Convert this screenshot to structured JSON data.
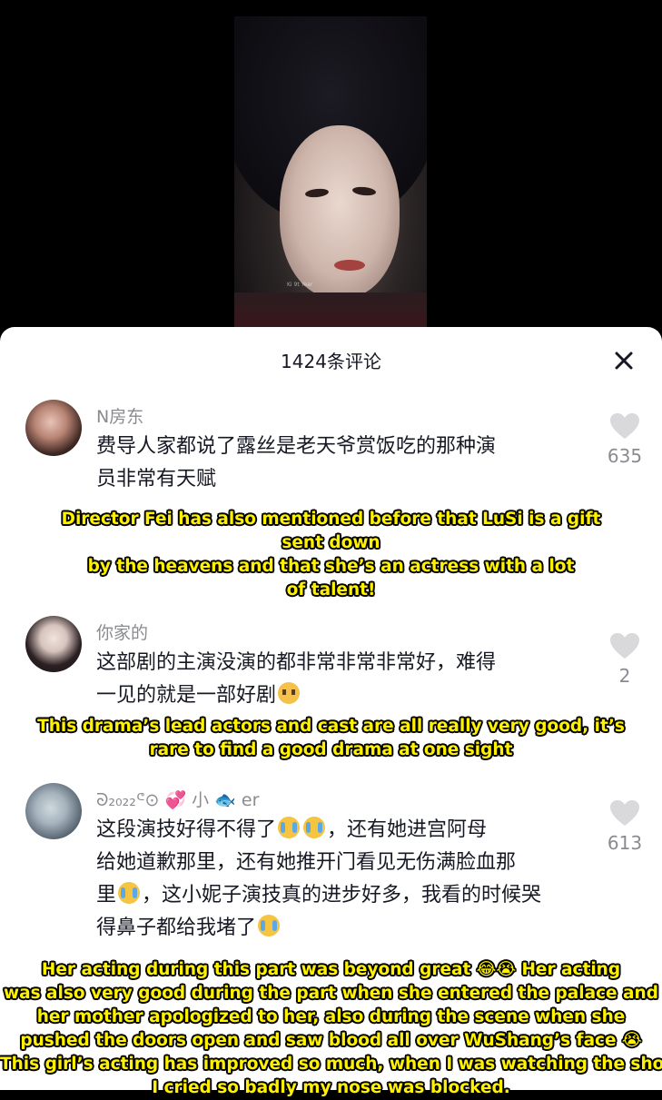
{
  "video": {
    "watermark": "Ki 9t Year"
  },
  "comments_panel": {
    "title": "1424条评论",
    "close_icon": "close-icon"
  },
  "comments": [
    {
      "username": "N房东",
      "text_lines": [
        "费导人家都说了露丝是老天爷赏饭吃的那种演",
        "员非常有天赋"
      ],
      "likes": "635",
      "caption_lines": [
        "Director Fei has also mentioned before that LuSi is a gift",
        "sent down",
        "by the heavens and that she’s an actress with a lot",
        "of talent!"
      ]
    },
    {
      "username": "你家的",
      "text_lines": [
        "这部剧的主演没演的都非常非常非常好，难得",
        "一见的就是一部好剧"
      ],
      "likes": "2",
      "caption_lines": [
        "This drama’s lead actors and cast are all really very good, it’s",
        "rare to find a good drama at one sight"
      ]
    },
    {
      "username": "ᘐ₂₀₂₂ᕪ⊙ 💞 小 🐟 er",
      "text_lines": [
        "这段演技好得不得了",
        "，还有她进宫阿母",
        "给她道歉那里，还有她推开门看见无伤满脸血那",
        "里",
        "，这小妮子演技真的进步好多，我看的时候哭",
        "得鼻子都给我堵了"
      ],
      "likes": "613",
      "caption_lines": [
        "Her acting during this part was beyond great 😂😭  Her acting",
        "was also very good during the part when she entered the palace and",
        "her mother apologized to her, also during the scene when she",
        "pushed the doors open and saw blood all over WuShang’s  face 😭",
        "This girl’s acting has improved so much, when I was watching the show,",
        "I cried so badly my nose was blocked."
      ]
    }
  ],
  "colors": {
    "caption_fill": "#fff200",
    "caption_outline": "#000000",
    "username": "#8a8b91",
    "text": "#161823"
  }
}
